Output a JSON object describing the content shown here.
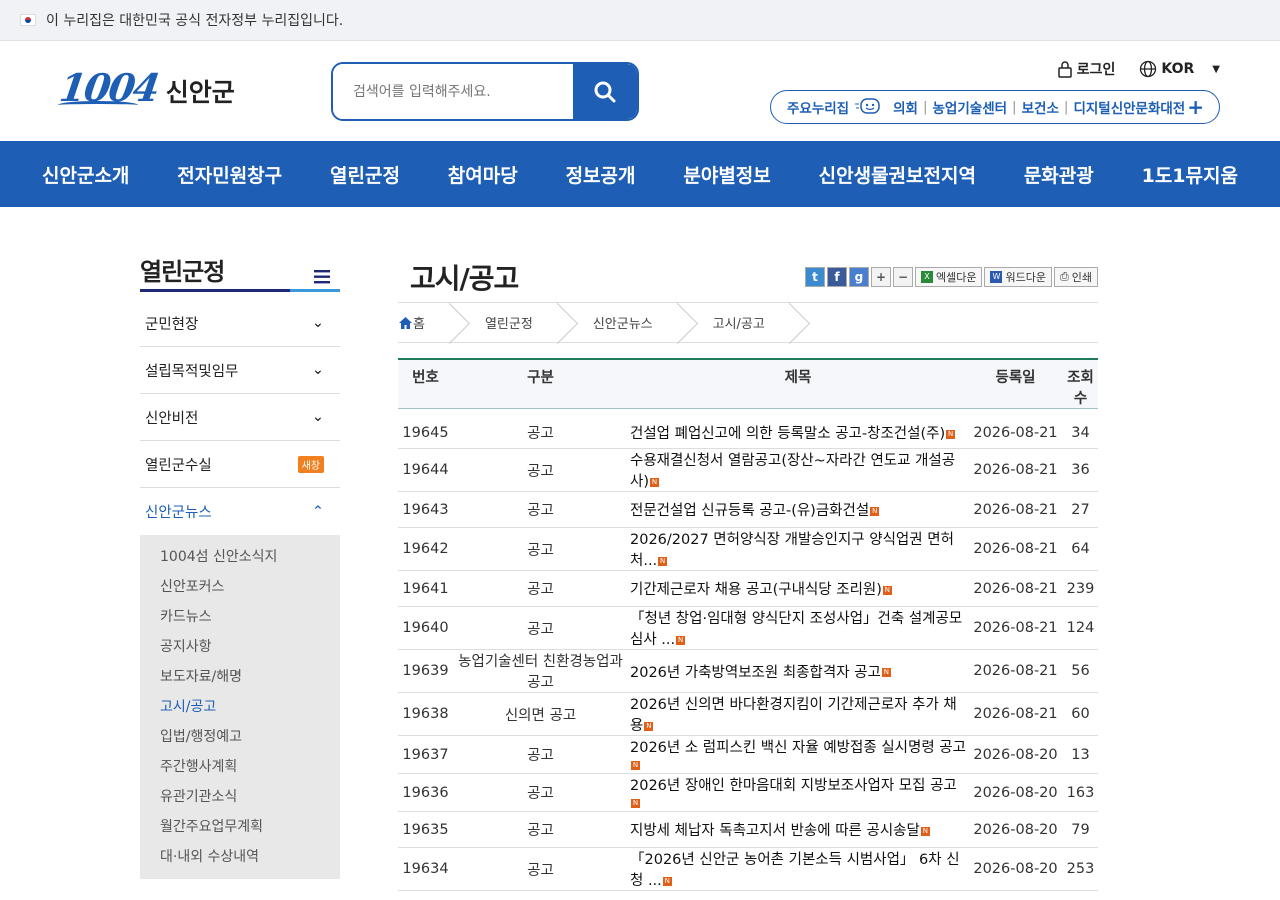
{
  "gov_bar": {
    "text": "이 누리집은 대한민국 공식 전자정부 누리집입니다."
  },
  "header": {
    "logo_num": "1004",
    "logo_text": "신안군",
    "search_placeholder": "검색어를 입력해주세요.",
    "login": "로그인",
    "lang": "KOR",
    "quick_label": "주요누리집",
    "quick_links": [
      "의회",
      "농업기술센터",
      "보건소",
      "디지털신안문화대전"
    ]
  },
  "gnb": [
    "신안군소개",
    "전자민원창구",
    "열린군정",
    "참여마당",
    "정보공개",
    "분야별정보",
    "신안생물권보전지역",
    "문화관광",
    "1도1뮤지움"
  ],
  "lnb": {
    "title": "열린군정",
    "items": [
      {
        "label": "군민현장"
      },
      {
        "label": "설립목적및임무"
      },
      {
        "label": "신안비전"
      },
      {
        "label": "열린군수실",
        "badge": "새창"
      },
      {
        "label": "신안군뉴스"
      }
    ],
    "sub": [
      "1004섬 신안소식지",
      "신안포커스",
      "카드뉴스",
      "공지사항",
      "보도자료/해명",
      "고시/공고",
      "입법/행정예고",
      "주간행사계획",
      "유관기관소식",
      "월간주요업무계획",
      "대·내외 수상내역"
    ]
  },
  "content": {
    "title": "고시/공고",
    "tools": {
      "excel": "엑셀다운",
      "word": "워드다운",
      "print": "인쇄"
    },
    "breadcrumb": [
      "홈",
      "열린군정",
      "신안군뉴스",
      "고시/공고"
    ],
    "columns": [
      "번호",
      "구분",
      "제목",
      "등록일",
      "조회수"
    ],
    "rows": [
      [
        "19645",
        "공고",
        "건설업 폐업신고에 의한 등록말소 공고-창조건설(주)",
        "2026-08-21",
        "34"
      ],
      [
        "19644",
        "공고",
        "수용재결신청서 열람공고(장산~자라간 연도교 개설공사)",
        "2026-08-21",
        "36"
      ],
      [
        "19643",
        "공고",
        "전문건설업 신규등록 공고-(유)금화건설",
        "2026-08-21",
        "27"
      ],
      [
        "19642",
        "공고",
        "2026/2027 면허양식장 개발승인지구 양식업권 면허 처...",
        "2026-08-21",
        "64"
      ],
      [
        "19641",
        "공고",
        "기간제근로자 채용 공고(구내식당 조리원)",
        "2026-08-21",
        "239"
      ],
      [
        "19640",
        "공고",
        "「청년 창업·임대형 양식단지 조성사업」건축 설계공모 심사 ...",
        "2026-08-21",
        "124"
      ],
      [
        "19639",
        "농업기술센터 친환경농업과 공고",
        "2026년 가축방역보조원 최종합격자 공고",
        "2026-08-21",
        "56"
      ],
      [
        "19638",
        "신의면 공고",
        "2026년 신의면 바다환경지킴이 기간제근로자 추가 채용",
        "2026-08-21",
        "60"
      ],
      [
        "19637",
        "공고",
        "2026년 소 럼피스킨 백신 자율 예방접종 실시명령 공고",
        "2026-08-20",
        "13"
      ],
      [
        "19636",
        "공고",
        "2026년 장애인 한마음대회 지방보조사업자 모집 공고",
        "2026-08-20",
        "163"
      ],
      [
        "19635",
        "공고",
        "지방세 체납자 독촉고지서 반송에 따른 공시송달",
        "2026-08-20",
        "79"
      ],
      [
        "19634",
        "공고",
        "「2026년 신안군 농어촌 기본소득 시범사업」 6차 신청 ...",
        "2026-08-20",
        "253"
      ]
    ]
  }
}
